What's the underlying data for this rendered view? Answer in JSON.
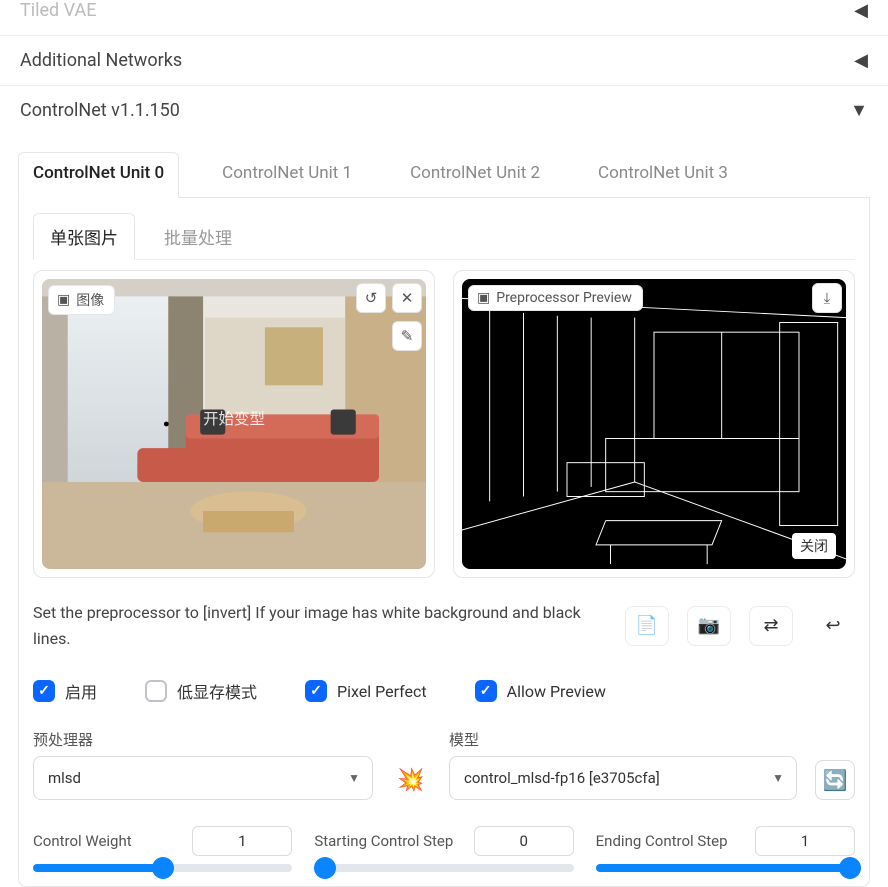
{
  "accordions": {
    "tiled_vae": "Tiled VAE",
    "additional_networks": "Additional Networks",
    "controlnet": "ControlNet v1.1.150"
  },
  "tabs": [
    "ControlNet Unit 0",
    "ControlNet Unit 1",
    "ControlNet Unit 2",
    "ControlNet Unit 3"
  ],
  "inner_tabs": {
    "single": "单张图片",
    "batch": "批量处理"
  },
  "image_card": {
    "label": "图像",
    "overlay": "开始变型"
  },
  "preview_card": {
    "label": "Preprocessor Preview",
    "close": "关闭"
  },
  "hint": "Set the preprocessor to [invert] If your image has white background and black lines.",
  "checks": {
    "enable": "启用",
    "lowvram": "低显存模式",
    "pixel_perfect": "Pixel Perfect",
    "allow_preview": "Allow Preview"
  },
  "preproc": {
    "label": "预处理器",
    "value": "mlsd"
  },
  "model": {
    "label": "模型",
    "value": "control_mlsd-fp16 [e3705cfa]"
  },
  "sliders": {
    "control_weight": {
      "label": "Control Weight",
      "value": "1",
      "fill": 50
    },
    "start_step": {
      "label": "Starting Control Step",
      "value": "0",
      "fill": 0
    },
    "end_step": {
      "label": "Ending Control Step",
      "value": "1",
      "fill": 100
    }
  }
}
